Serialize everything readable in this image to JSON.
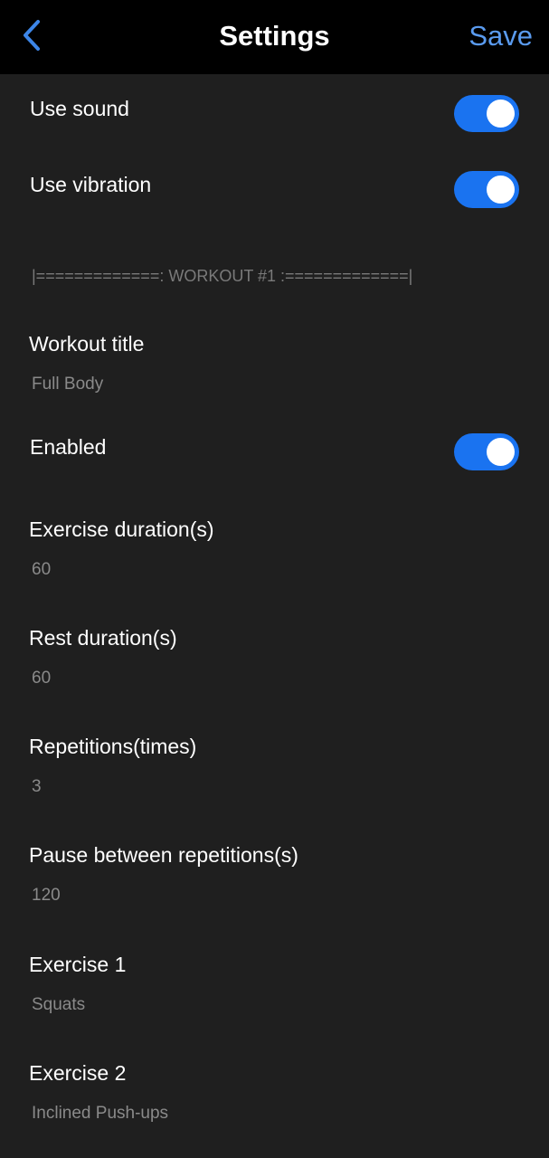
{
  "header": {
    "back_icon": "chevron-left-icon",
    "title": "Settings",
    "save_label": "Save",
    "accent_color": "#5a9bef"
  },
  "general": {
    "use_sound": {
      "label": "Use sound",
      "on": true
    },
    "use_vibration": {
      "label": "Use vibration",
      "on": true
    }
  },
  "workout": {
    "separator": "|=============: WORKOUT #1 :=============|",
    "title_field": {
      "label": "Workout title",
      "value": "Full Body"
    },
    "enabled": {
      "label": "Enabled",
      "on": true
    },
    "exercise_duration": {
      "label": "Exercise duration(s)",
      "value": "60"
    },
    "rest_duration": {
      "label": "Rest duration(s)",
      "value": "60"
    },
    "repetitions": {
      "label": "Repetitions(times)",
      "value": "3"
    },
    "pause": {
      "label": "Pause between repetitions(s)",
      "value": "120"
    },
    "exercise_1": {
      "label": "Exercise 1",
      "value": "Squats"
    },
    "exercise_2": {
      "label": "Exercise 2",
      "value": "Inclined Push-ups"
    }
  },
  "colors": {
    "background": "#1f1f1f",
    "header": "#000000",
    "toggle_on": "#1a73f0"
  }
}
